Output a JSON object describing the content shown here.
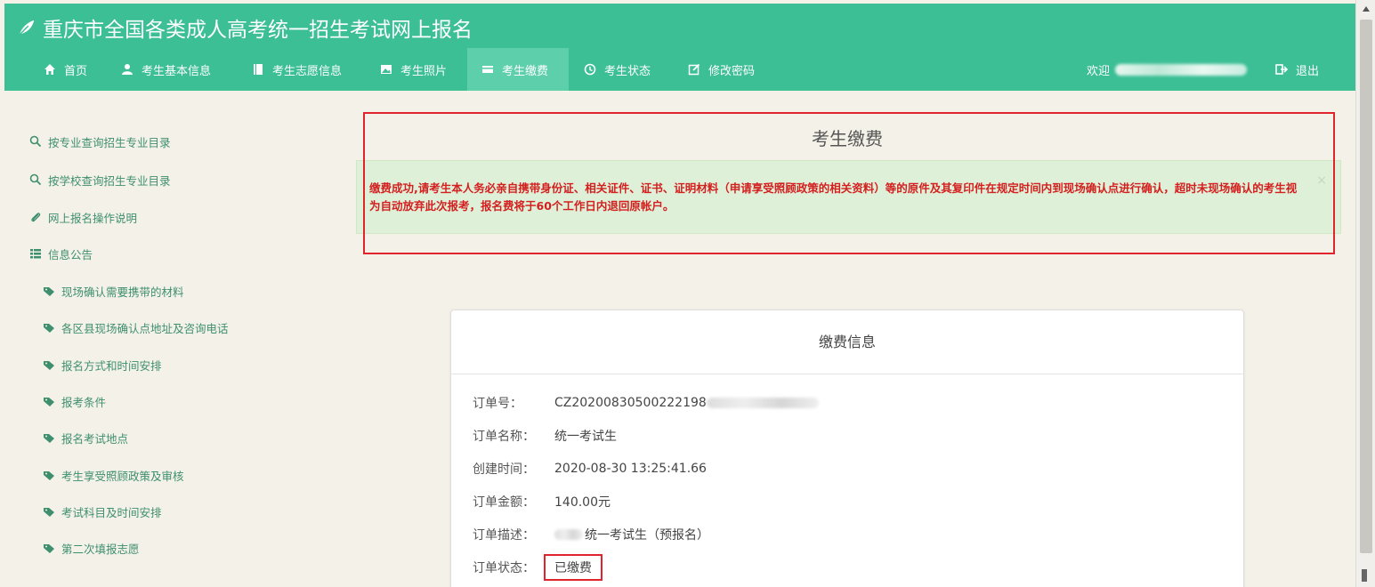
{
  "header": {
    "title": "重庆市全国各类成人高考统一招生考试网上报名",
    "nav": [
      {
        "label": "首页",
        "icon": "home-icon"
      },
      {
        "label": "考生基本信息",
        "icon": "user-icon"
      },
      {
        "label": "考生志愿信息",
        "icon": "book-icon"
      },
      {
        "label": "考生照片",
        "icon": "picture-icon"
      },
      {
        "label": "考生缴费",
        "icon": "credit-card-icon",
        "active": true
      },
      {
        "label": "考生状态",
        "icon": "clock-icon"
      },
      {
        "label": "修改密码",
        "icon": "edit-icon"
      }
    ],
    "welcome_label": "欢迎",
    "logout_label": "退出"
  },
  "sidebar": {
    "links": [
      {
        "label": "按专业查询招生专业目录",
        "icon": "search-icon"
      },
      {
        "label": "按学校查询招生专业目录",
        "icon": "search-icon"
      },
      {
        "label": "网上报名操作说明",
        "icon": "paperclip-icon"
      }
    ],
    "section_heading": "信息公告",
    "announcements": [
      "现场确认需要携带的材料",
      "各区县现场确认点地址及咨询电话",
      "报名方式和时间安排",
      "报考条件",
      "报名考试地点",
      "考生享受照顾政策及审核",
      "考试科目及时间安排",
      "第二次填报志愿"
    ]
  },
  "main": {
    "panel_title": "考生缴费",
    "alert": {
      "text": "缴费成功,请考生本人务必亲自携带身份证、相关证件、证书、证明材料（申请享受照顾政策的相关资料）等的原件及其复印件在规定时间内到现场确认点进行确认，超时未现场确认的考生视为自动放弃此次报考，报名费将于60个工作日内退回原帐户。",
      "close": "×"
    },
    "payment": {
      "title": "缴费信息",
      "rows": [
        {
          "label": "订单号：",
          "value": "CZ20200830500222198"
        },
        {
          "label": "订单名称：",
          "value": "统一考试生"
        },
        {
          "label": "创建时间：",
          "value": "2020-08-30 13:25:41.66"
        },
        {
          "label": "订单金额：",
          "value": "140.00元"
        },
        {
          "label": "订单描述：",
          "value": "统一考试生（预报名）"
        },
        {
          "label": "订单状态：",
          "value": "已缴费"
        }
      ]
    }
  }
}
